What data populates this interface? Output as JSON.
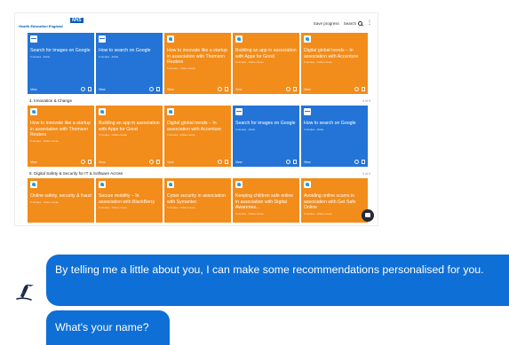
{
  "portal": {
    "nhs_logo": "NHS",
    "org_name": "Health Education England",
    "save_progress": "Save progress",
    "search_label": "Search",
    "section_a_title": "4. Innovation & Change",
    "section_b_title": "5. Digital Safety & Security for IT & Software Across",
    "see_all": "9 of 9",
    "row1": [
      {
        "title": "Search for images on Google",
        "meta": "3 minutes · Article",
        "view": "View",
        "color": "blue"
      },
      {
        "title": "How to search on Google",
        "meta": "3 minutes · Article",
        "view": "View",
        "color": "blue"
      },
      {
        "title": "How to innovate like a startup in association with Thomson Reuters",
        "meta": "5 minutes · Online course",
        "view": "View",
        "color": "orange"
      },
      {
        "title": "Building an app in association with Apps for Good",
        "meta": "5 minutes · Online course",
        "view": "View",
        "color": "orange"
      },
      {
        "title": "Digital global trends – In association with Accenture",
        "meta": "5 minutes · Online course",
        "view": "View",
        "color": "orange"
      }
    ],
    "row2": [
      {
        "title": "How to innovate like a startup in association with Thomson Reuters",
        "meta": "5 minutes · Online course",
        "view": "View",
        "color": "orange"
      },
      {
        "title": "Building an app in association with Apps for Good",
        "meta": "5 minutes · Online course",
        "view": "View",
        "color": "orange"
      },
      {
        "title": "Digital global trends – In association with Accenture",
        "meta": "5 minutes · Online course",
        "view": "View",
        "color": "orange"
      },
      {
        "title": "Search for images on Google",
        "meta": "3 minutes · Article",
        "view": "View",
        "color": "blue"
      },
      {
        "title": "How to search on Google",
        "meta": "3 minutes · Article",
        "view": "View",
        "color": "blue"
      }
    ],
    "row3": [
      {
        "title": "Online safety, security & fraud",
        "meta": "5 minutes · Online course",
        "color": "orange"
      },
      {
        "title": "Secure mobility – In association with BlackBerry",
        "meta": "5 minutes · Online course",
        "color": "orange"
      },
      {
        "title": "Cyber security in association with Symantec",
        "meta": "5 minutes · Online course",
        "color": "orange"
      },
      {
        "title": "Keeping children safe online in association with Digital Awarenes...",
        "meta": "5 minutes · Online course",
        "color": "orange"
      },
      {
        "title": "Avoiding online scams in association with Get Safe Online",
        "meta": "5 minutes · Online course",
        "color": "orange"
      }
    ]
  },
  "chat": {
    "message_1": "By telling me a little about you, I can make some recommendations personalised for you.",
    "message_2": "What's your name?"
  },
  "colors": {
    "orange": "#f28c1b",
    "blue": "#2374d6",
    "bubble": "#0e6fd6",
    "nhs_blue": "#005eb8"
  }
}
